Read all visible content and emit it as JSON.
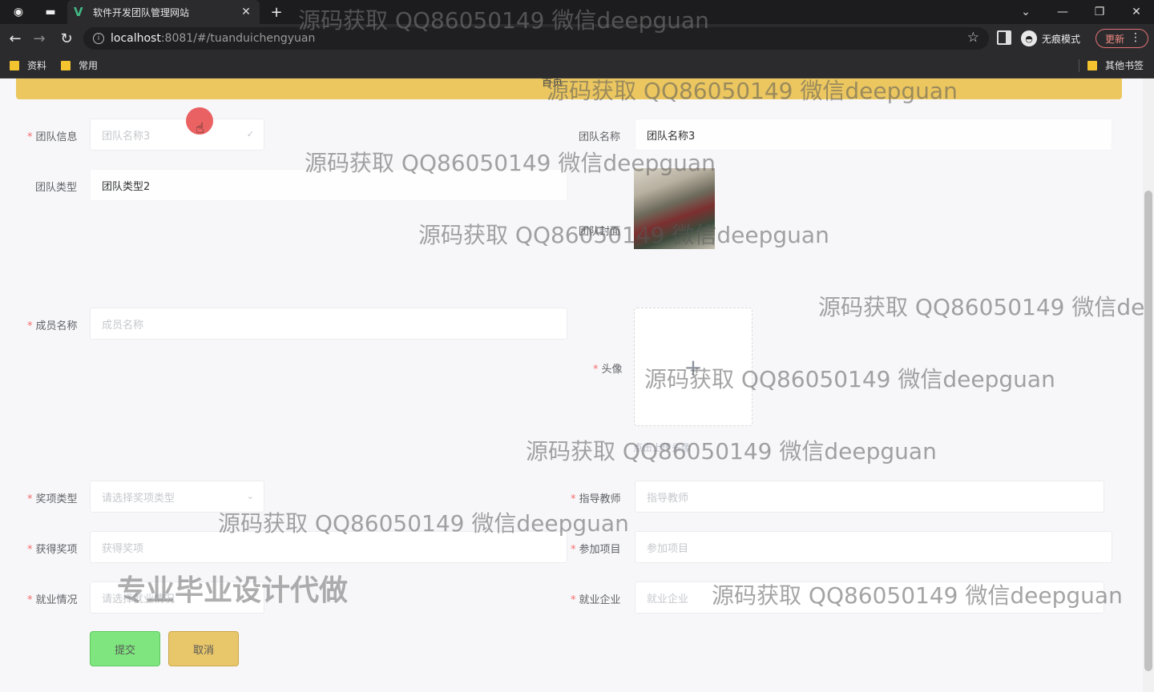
{
  "browser": {
    "tab_title": "软件开发团队管理网站",
    "tab_close": "✕",
    "new_tab": "+",
    "url_host": "localhost",
    "url_rest": ":8081/#/tuanduichengyuan",
    "incognito_label": "无痕模式",
    "update_label": "更新",
    "bookmarks": [
      "资料",
      "常用"
    ],
    "other_bookmarks": "其他书签"
  },
  "page": {
    "banner_text": "首页"
  },
  "form": {
    "team_info": {
      "label": "团队信息",
      "placeholder": "团队名称3"
    },
    "team_name": {
      "label": "团队名称",
      "value": "团队名称3"
    },
    "team_type": {
      "label": "团队类型",
      "value": "团队类型2"
    },
    "team_cover": {
      "label": "团队封面"
    },
    "member_name": {
      "label": "成员名称",
      "placeholder": "成员名称"
    },
    "avatar": {
      "label": "头像",
      "note": "点击上传头像"
    },
    "award_type": {
      "label": "奖项类型",
      "placeholder": "请选择奖项类型"
    },
    "advisor": {
      "label": "指导教师",
      "placeholder": "指导教师"
    },
    "award": {
      "label": "获得奖项",
      "placeholder": "获得奖项"
    },
    "project": {
      "label": "参加项目",
      "placeholder": "参加项目"
    },
    "employment": {
      "label": "就业情况",
      "placeholder": "请选择就业情况"
    },
    "company": {
      "label": "就业企业",
      "placeholder": "就业企业"
    },
    "submit_label": "提交",
    "cancel_label": "取消"
  },
  "watermarks": {
    "source_text": "源码获取 QQ86050149 微信deepguan",
    "source_text_cut": "源码获取 QQ86050149 微信de",
    "promo_text": "专业毕业设计代做"
  }
}
